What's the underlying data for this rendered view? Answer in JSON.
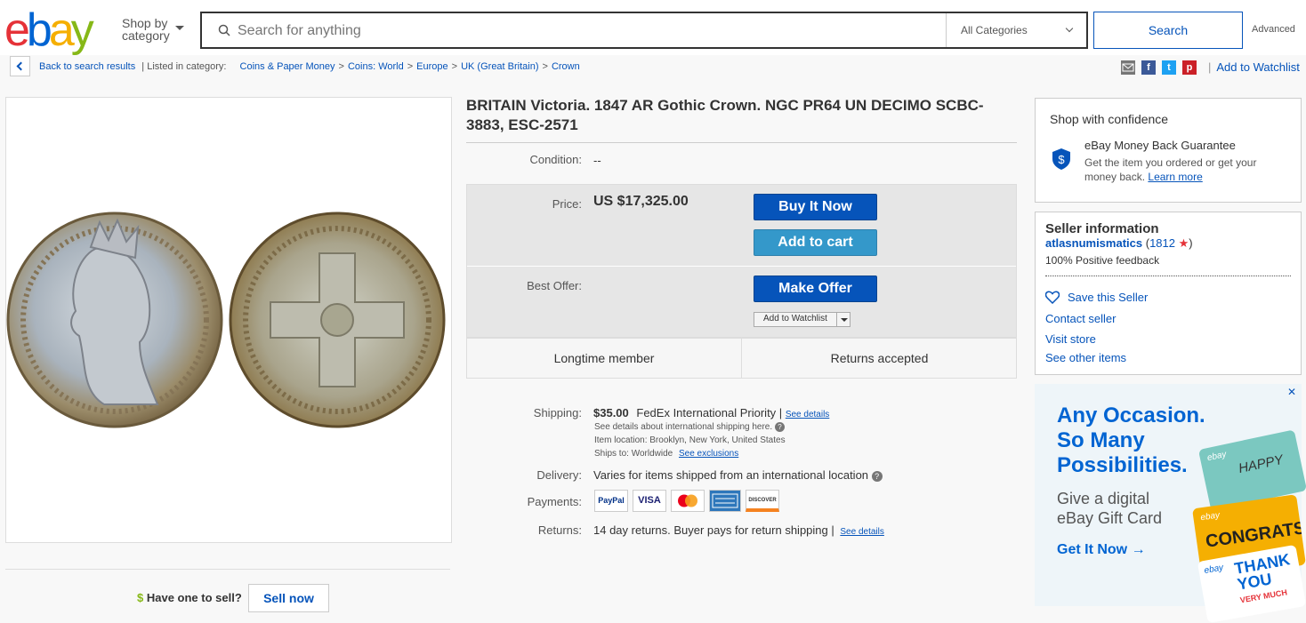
{
  "header": {
    "logo_letters": [
      "e",
      "b",
      "a",
      "y"
    ],
    "shop_by": [
      "Shop by",
      "category"
    ],
    "search_placeholder": "Search for anything",
    "category_select": "All Categories",
    "search_button": "Search",
    "advanced": "Advanced"
  },
  "breadcrumb": {
    "back": "Back to search results",
    "listed": "| Listed in category:",
    "items": [
      "Coins & Paper Money",
      "Coins: World",
      "Europe",
      "UK (Great Britain)",
      "Crown"
    ],
    "watchlist": "Add to Watchlist"
  },
  "item": {
    "title": "BRITAIN Victoria. 1847 AR Gothic Crown. NGC PR64 UN DECIMO SCBC-3883, ESC-2571",
    "condition_label": "Condition:",
    "condition_value": "--",
    "price_label": "Price:",
    "price_value": "US $17,325.00",
    "buy_now": "Buy It Now",
    "add_to_cart": "Add to cart",
    "best_offer_label": "Best Offer:",
    "make_offer": "Make Offer",
    "add_to_watchlist_small": "Add to Watchlist",
    "badge_left": "Longtime member",
    "badge_right": "Returns accepted"
  },
  "details": {
    "shipping_label": "Shipping:",
    "shipping_cost": "$35.00",
    "shipping_method": "FedEx International Priority |",
    "see_details": "See details",
    "intl_note": "See details about international shipping here.",
    "item_location_label": "Item location:",
    "item_location": "Brooklyn, New York, United States",
    "ships_to_label": "Ships to:",
    "ships_to": "Worldwide",
    "see_exclusions": "See exclusions",
    "delivery_label": "Delivery:",
    "delivery_value": "Varies for items shipped from an international location",
    "payments_label": "Payments:",
    "payment_methods": [
      "PayPal",
      "VISA",
      "",
      "",
      "DISCOVER"
    ],
    "returns_label": "Returns:",
    "returns_value": "14 day returns. Buyer pays for return shipping |",
    "returns_details": "See details"
  },
  "sell": {
    "question": "Have one to sell?",
    "button": "Sell now"
  },
  "confidence": {
    "title": "Shop with confidence",
    "guarantee": "eBay Money Back Guarantee",
    "desc": "Get the item you ordered or get your money back.",
    "learn_more": "Learn more"
  },
  "seller": {
    "title": "Seller information",
    "name": "atlasnumismatics",
    "score_open": "(",
    "score": "1812",
    "score_close": ")",
    "feedback": "100% Positive feedback",
    "save": "Save this Seller",
    "contact": "Contact seller",
    "visit": "Visit store",
    "other": "See other items"
  },
  "ad": {
    "headline": [
      "Any Occasion.",
      "So Many",
      "Possibilities."
    ],
    "sub": [
      "Give a digital",
      "eBay Gift Card"
    ],
    "cta": "Get It Now",
    "close": "✕",
    "card_labels": [
      "ebay",
      "ebay",
      "ebay"
    ],
    "card_texts": [
      "HAPPY",
      "CONGRATS",
      "THANK",
      "YOU",
      "VERY MUCH"
    ]
  },
  "colors": {
    "link": "#0654ba",
    "buy_now": "#0654ba",
    "cart": "#3498ca",
    "ad_blue": "#0064d2"
  }
}
